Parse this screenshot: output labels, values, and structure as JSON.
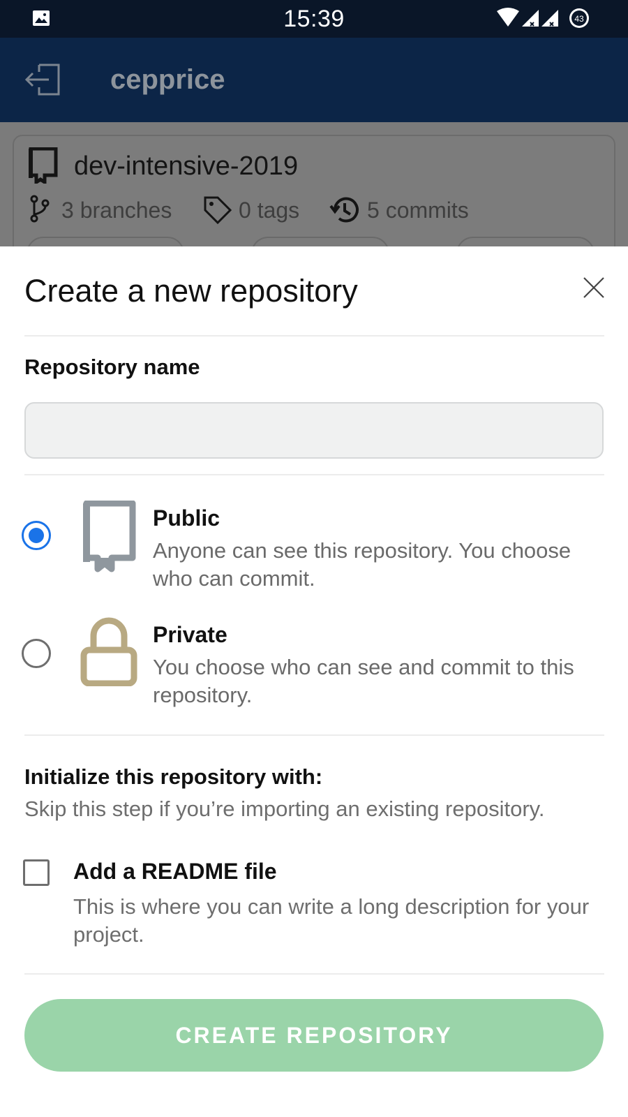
{
  "status_bar": {
    "time": "15:39",
    "battery_level": "43",
    "icons": [
      "gallery-icon",
      "wifi-icon",
      "signal-icon",
      "signal-icon",
      "battery-icon"
    ]
  },
  "app_bar": {
    "title": "cepprice",
    "leading_icon": "logout-icon"
  },
  "background_repo": {
    "name": "dev-intensive-2019",
    "branches": "3 branches",
    "tags": "0 tags",
    "commits": "5 commits"
  },
  "dialog": {
    "title": "Create a new repository",
    "close_icon": "close-icon",
    "repo_name_label": "Repository name",
    "repo_name_value": "",
    "visibility": {
      "selected": "public",
      "public": {
        "title": "Public",
        "description": "Anyone can see this repository. You choose who can commit.",
        "icon": "repo-book-icon"
      },
      "private": {
        "title": "Private",
        "description": "You choose who can see and commit to this repository.",
        "icon": "lock-icon"
      }
    },
    "init_label": "Initialize this repository with:",
    "init_description": "Skip this step if you’re importing an existing repository.",
    "readme": {
      "title": "Add a README file",
      "description": "This is where you can write a long description for your project.",
      "checked": false
    },
    "create_button": "CREATE REPOSITORY"
  },
  "colors": {
    "status_bar_bg": "#0a1628",
    "app_bar_dim_bg": "#0c2547",
    "accent_blue": "#1a73e8",
    "button_green_disabled": "#9ad4a9",
    "lock_color": "#b8a982",
    "book_color": "#8f979e"
  }
}
